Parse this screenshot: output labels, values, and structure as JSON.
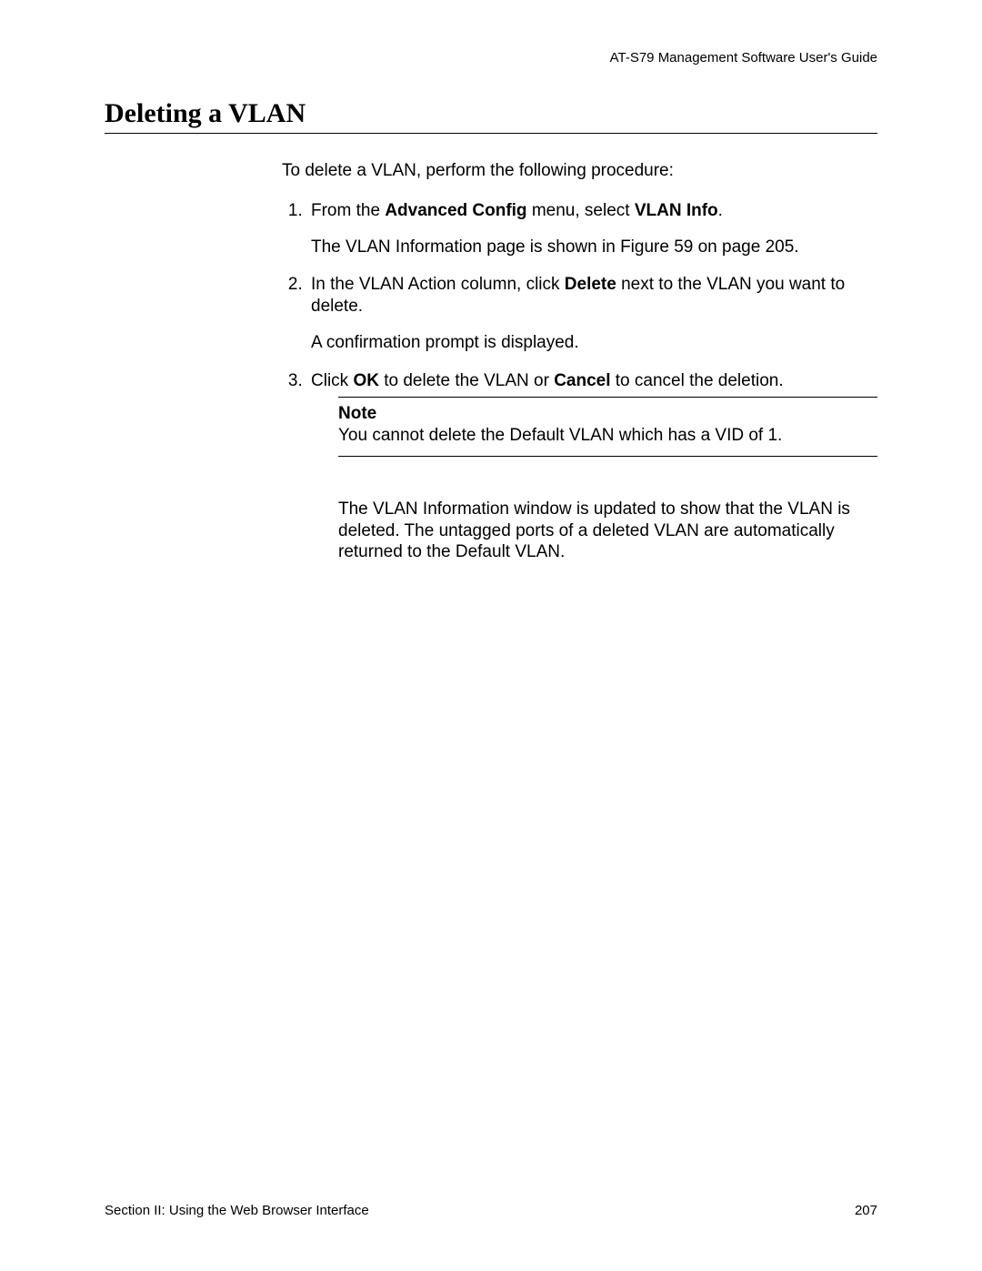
{
  "header": {
    "running": "AT-S79 Management Software User's Guide"
  },
  "title": "Deleting a VLAN",
  "intro": "To delete a VLAN, perform the following procedure:",
  "steps": {
    "s1": {
      "pre": "From the ",
      "bold1": "Advanced Config",
      "mid": " menu, select ",
      "bold2": "VLAN Info",
      "post": ".",
      "para": "The VLAN Information page is shown in Figure 59 on page 205."
    },
    "s2": {
      "pre": "In the VLAN Action column, click ",
      "bold1": "Delete",
      "post": " next to the VLAN you want to delete.",
      "para": "A confirmation prompt is displayed."
    },
    "s3": {
      "pre": "Click ",
      "bold1": "OK",
      "mid": " to delete the VLAN or ",
      "bold2": "Cancel",
      "post": " to cancel the deletion."
    }
  },
  "note": {
    "label": "Note",
    "text": "You cannot delete the Default VLAN which has a VID of 1."
  },
  "after_note": "The VLAN Information window is updated to show that the VLAN is deleted. The untagged ports of a deleted VLAN are automatically returned to the Default VLAN.",
  "footer": {
    "section": "Section II: Using the Web Browser Interface",
    "page_number": "207"
  }
}
